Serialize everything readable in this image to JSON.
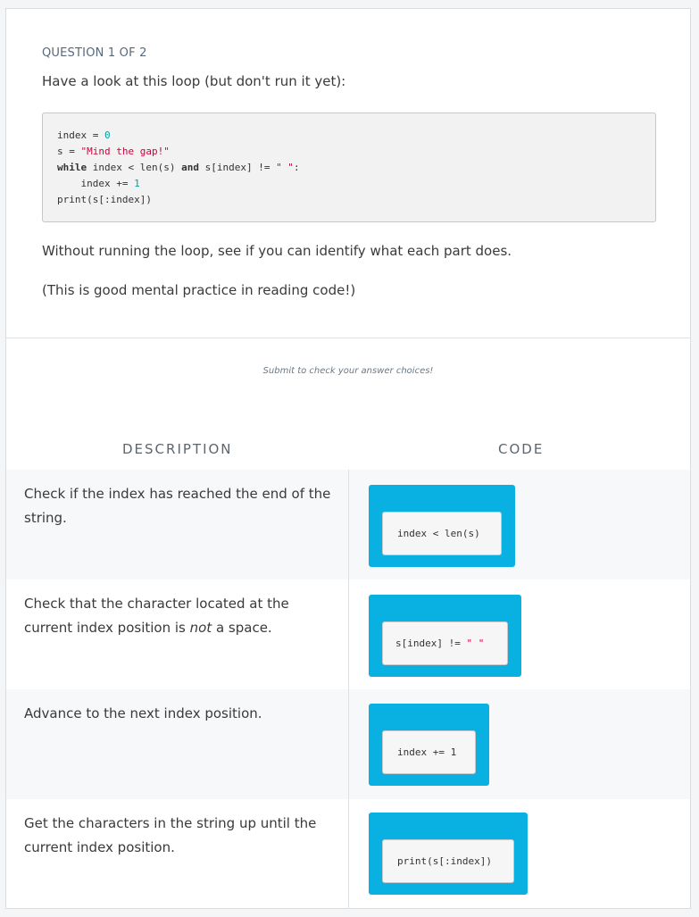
{
  "question": {
    "label": "QUESTION 1 OF 2",
    "intro": "Have a look at this loop (but don't run it yet):",
    "code_lines": {
      "line1": {
        "a": "index = ",
        "b": "0"
      },
      "line2": {
        "a": "s = ",
        "b": "\"Mind the gap!\""
      },
      "line3": {
        "kw1": "while",
        "a": " index < len(s) ",
        "kw2": "and",
        "b": " s[index] != ",
        "c": "\" \"",
        "d": ":"
      },
      "line4": {
        "a": "    index += ",
        "b": "1"
      },
      "line5": {
        "a": "print(s[:index])"
      }
    },
    "paragraph1": "Without running the loop, see if you can identify what each part does.",
    "paragraph2": "(This is good mental practice in reading code!)"
  },
  "hint": "Submit to check your answer choices!",
  "columns": {
    "description": "DESCRIPTION",
    "code": "CODE"
  },
  "rows": [
    {
      "desc_a": "Check if the index has reached the end of the string.",
      "desc_em": "",
      "desc_b": "",
      "chip": {
        "a": "index < len(s)",
        "b": ""
      }
    },
    {
      "desc_a": "Check that the character located at the current index position is ",
      "desc_em": "not",
      "desc_b": " a space.",
      "chip": {
        "a": "s[index] != ",
        "b": "\" \""
      }
    },
    {
      "desc_a": "Advance to the next index position.",
      "desc_em": "",
      "desc_b": "",
      "chip": {
        "a": "index += 1",
        "b": ""
      }
    },
    {
      "desc_a": "Get the characters in the string up until the current index position.",
      "desc_em": "",
      "desc_b": "",
      "chip": {
        "a": "print(s[:index])",
        "b": ""
      }
    }
  ],
  "colors": {
    "tile": "#09b1e3",
    "string": "#d1003b",
    "number": "#00a3a3"
  }
}
